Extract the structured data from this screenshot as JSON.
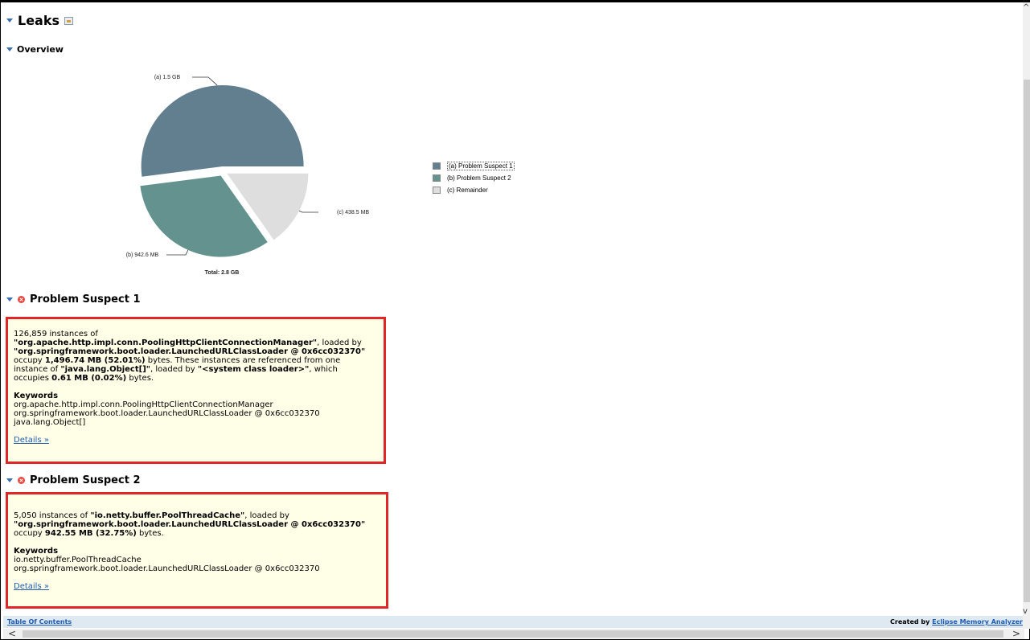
{
  "page": {
    "title": "Leaks",
    "overview_label": "Overview"
  },
  "chart_data": {
    "type": "pie",
    "unit": "MB",
    "slices": [
      {
        "label": "(a)",
        "legend": "(a) Problem Suspect 1",
        "callout": "(a) 1.5 GB",
        "value": 1496.74,
        "color": "#617f8e"
      },
      {
        "label": "(b)",
        "legend": "(b) Problem Suspect 2",
        "callout": "(b) 942.6 MB",
        "value": 942.55,
        "color": "#64938f"
      },
      {
        "label": "(c)",
        "legend": "(c) Remainder",
        "callout": "(c) 438.5 MB",
        "value": 438.5,
        "color": "#dedede"
      }
    ],
    "total_label": "Total: 2.8 GB",
    "legend_position": "right"
  },
  "suspect1": {
    "heading": "Problem Suspect 1",
    "line1": "126,859 instances of",
    "class_name": "\"org.apache.http.impl.conn.PoolingHttpClientConnectionManager\"",
    "loaded_by_text": ", loaded by",
    "loader": "\"org.springframework.boot.loader.LaunchedURLClassLoader @ 0x6cc032370\"",
    "occupy_pre": "occupy ",
    "occupy_value": "1,496.74 MB (52.01%)",
    "occupy_post": " bytes. These instances are referenced from one",
    "instance_pre": "instance of ",
    "ref_class": "\"java.lang.Object[]\"",
    "ref_loaded_by": ", loaded by ",
    "ref_loader": "\"<system class loader>\"",
    "ref_post": ", which",
    "occupies_pre": "occupies ",
    "occupies_value": "0.61 MB (0.02%)",
    "occupies_post": " bytes.",
    "keywords_label": "Keywords",
    "keywords": [
      "org.apache.http.impl.conn.PoolingHttpClientConnectionManager",
      "org.springframework.boot.loader.LaunchedURLClassLoader @ 0x6cc032370",
      "java.lang.Object[]"
    ],
    "details_link": "Details »"
  },
  "suspect2": {
    "heading": "Problem Suspect 2",
    "line1_pre": "5,050 instances of ",
    "class_name": "\"io.netty.buffer.PoolThreadCache\"",
    "loaded_by_text": ", loaded by",
    "loader": "\"org.springframework.boot.loader.LaunchedURLClassLoader @ 0x6cc032370\"",
    "occupy_pre": "occupy ",
    "occupy_value": "942.55 MB (32.75%)",
    "occupy_post": " bytes.",
    "keywords_label": "Keywords",
    "keywords": [
      "io.netty.buffer.PoolThreadCache",
      "org.springframework.boot.loader.LaunchedURLClassLoader @ 0x6cc032370"
    ],
    "details_link": "Details »"
  },
  "footer": {
    "toc_link": "Table Of Contents",
    "created_by": "Created by ",
    "created_link": "Eclipse Memory Analyzer"
  },
  "scrollbars": {
    "left_arrow": "<",
    "right_arrow": ">",
    "up_arrow": "^",
    "down_arrow": "v"
  }
}
